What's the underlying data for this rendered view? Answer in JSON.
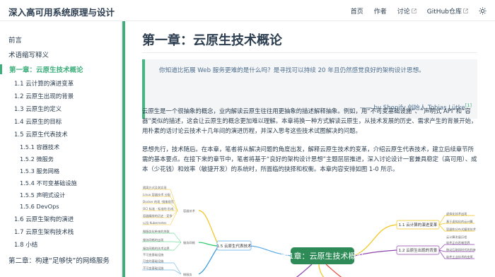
{
  "header": {
    "site_title": "深入高可用系统原理与设计",
    "nav": [
      {
        "label": "首页"
      },
      {
        "label": "作者"
      },
      {
        "label": "讨论"
      },
      {
        "label": "GitHub仓库"
      }
    ]
  },
  "sidebar": {
    "items": [
      {
        "label": "前言"
      },
      {
        "label": "术语缩写释义"
      },
      {
        "label": "第一章：云原生技术概论"
      },
      {
        "label": "1.1 云计算的演进变革"
      },
      {
        "label": "1.2 云原生出现的背景"
      },
      {
        "label": "1.3 云原生的定义"
      },
      {
        "label": "1.4 云原生的目标"
      },
      {
        "label": "1.5 云原生代表技术"
      },
      {
        "label": "1.5.1 容器技术"
      },
      {
        "label": "1.5.2 微服务"
      },
      {
        "label": "1.5.3 服务网格"
      },
      {
        "label": "1.5.4 不可变基础设施"
      },
      {
        "label": "1.5.5 声明式设计"
      },
      {
        "label": "1.5.6 DevOps"
      },
      {
        "label": "1.6 云原生架构的演进"
      },
      {
        "label": "1.7 云原生架构技术栈"
      },
      {
        "label": "1.8 小结"
      },
      {
        "label": "第二章：构建“足够快”的网络服务"
      }
    ]
  },
  "main": {
    "title": "第一章：云原生技术概论",
    "quote": {
      "text": "你知道比拓展 Web 服务更难的是什么吗？是寻找可以持续 20 年且仍然感觉良好的架构设计思想。",
      "attribution": "—— by Shopify 创始人 Tobias Lütke",
      "footnote": "[1]"
    },
    "paragraphs": [
      "云原生是一个很抽象的概念，业内解读云原生往往用更抽象的描述解释抽象。例如，用“不可变基础设施”、“声明式 API”和“容器”类似的描述，这会让云原生的概念更加难以理解。本章将换一种方式解读云原生，从技术发展的历史、需求产生的背景开始，用朴素的话讨论云技术十几年间的演进历程，并深入思考这些技术试图解决的问题。",
      "思想先行，技术随后。在本章，笔者将从解决问题的角度出发，解释云原生技术的变革，介绍云原生代表技术，建立后续章节所需的基本要点。在接下来的章节中，笔者将基于“良好的架构设计思想”主题层层推进，深入讨论设计一套兼具稳定（高可用）、成本（少花钱）和效率（敏捷开发）的系统时，所面临的抉择和权衡。本章内容安排如图 1-0 所示。"
    ],
    "mindmap": {
      "root": "第1章：云原生技术概论",
      "left_branch": "1.5 云原生代表技术",
      "right_nodes": [
        "1.1 云计算的演进变革",
        "1.2 云原生出现的背景"
      ],
      "left_subs": [
        "容器技术",
        "服务网格",
        "微服务"
      ],
      "left_leaves": [
        "隔离方式及其实现",
        "Linux 容器技术 分配",
        "Docker 的现 ·镜像规范",
        "OCI 标准 · 标准的 形成",
        "容器编排的历史 · 竞争",
        "以及 Kubernetes",
        "微服务化带来的关联",
        "服务网格的出现",
        "服务网格的技术边界",
        "不可变基础设施",
        "可变的基础设施",
        "不可变基础设施"
      ],
      "right_leaves": [
        "虚拟化技术出现",
        "基于虚拟化的云计算",
        "容器和分布式编排技术",
        "云计算发展历程",
        "软件正在吞噬世界",
        "移动互联网时代的到来",
        "软件工业技术的变革"
      ]
    }
  },
  "colors": {
    "accent": "#3eaf7c",
    "quote_bg": "#f3f5f7",
    "mindmap_root": "#2e8b57",
    "mindmap_yellow": "#f5c518",
    "mindmap_blue": "#5aa9e6",
    "mindmap_purple": "#8e44ad",
    "mindmap_red": "#e74c3c"
  },
  "icons": {
    "external_link": "external-link-icon",
    "theme_toggle": "sun-icon"
  }
}
